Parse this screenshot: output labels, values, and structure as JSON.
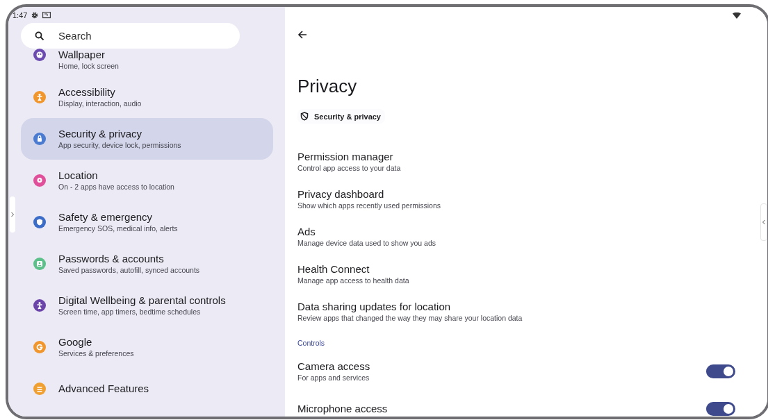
{
  "status_bar": {
    "time": "1:47"
  },
  "sidebar": {
    "search": {
      "placeholder": "Search"
    },
    "items": [
      {
        "title": "Wallpaper",
        "subtitle": "Home, lock screen",
        "color": "#6c4bb0",
        "selected": false
      },
      {
        "title": "Accessibility",
        "subtitle": "Display, interaction, audio",
        "color": "#f0962c",
        "selected": false
      },
      {
        "title": "Security & privacy",
        "subtitle": "App security, device lock, permissions",
        "color": "#4a7bd0",
        "selected": true
      },
      {
        "title": "Location",
        "subtitle": "On - 2 apps have access to location",
        "color": "#e0509a",
        "selected": false
      },
      {
        "title": "Safety & emergency",
        "subtitle": "Emergency SOS, medical info, alerts",
        "color": "#3a6cc8",
        "selected": false
      },
      {
        "title": "Passwords & accounts",
        "subtitle": "Saved passwords, autofill, synced accounts",
        "color": "#5cc08a",
        "selected": false
      },
      {
        "title": "Digital Wellbeing & parental controls",
        "subtitle": "Screen time, app timers, bedtime schedules",
        "color": "#6a44a8",
        "selected": false
      },
      {
        "title": "Google",
        "subtitle": "Services & preferences",
        "color": "#f0962c",
        "selected": false
      },
      {
        "title": "Advanced Features",
        "color": "#f0a030",
        "selected": false
      }
    ]
  },
  "page": {
    "title": "Privacy",
    "breadcrumb": "Security & privacy",
    "items": [
      {
        "kind": "link",
        "title": "Permission manager",
        "subtitle": "Control app access to your data"
      },
      {
        "kind": "link",
        "title": "Privacy dashboard",
        "subtitle": "Show which apps recently used permissions"
      },
      {
        "kind": "link",
        "title": "Ads",
        "subtitle": "Manage device data used to show you ads"
      },
      {
        "kind": "link",
        "title": "Health Connect",
        "subtitle": "Manage app access to health data"
      },
      {
        "kind": "link",
        "title": "Data sharing updates for location",
        "subtitle": "Review apps that changed the way they may share your location data"
      },
      {
        "kind": "header",
        "title": "Controls"
      },
      {
        "kind": "toggle",
        "title": "Camera access",
        "subtitle": "For apps and services",
        "on": true
      },
      {
        "kind": "toggle",
        "title": "Microphone access",
        "on": true
      }
    ]
  }
}
